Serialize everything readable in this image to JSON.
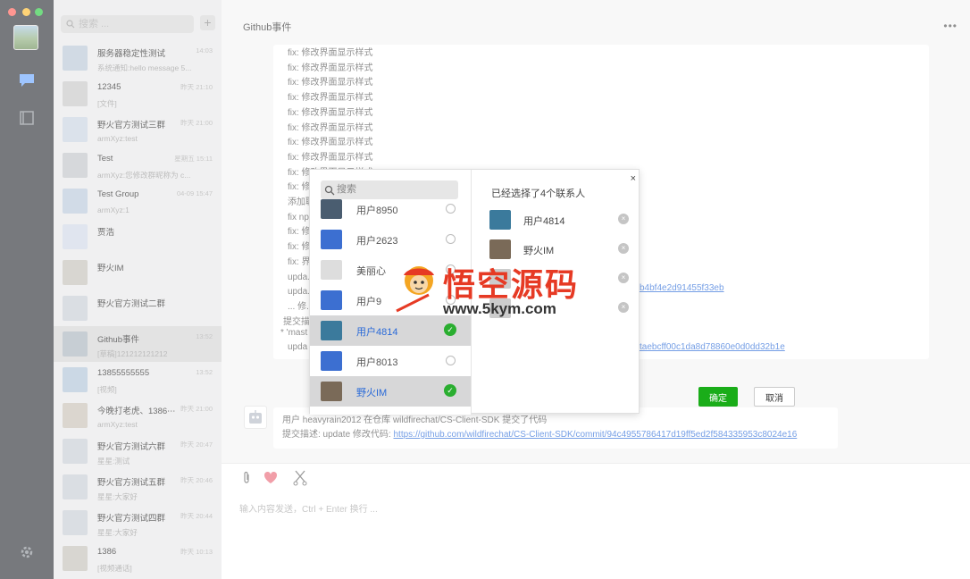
{
  "window": {
    "traffic_lights": [
      "#ff5f57",
      "#febc2e",
      "#28c840"
    ]
  },
  "sidebar": {
    "search_placeholder": "搜索 ...",
    "add_label": "+"
  },
  "conversations": [
    {
      "name": "服务器稳定性测试",
      "time": "14:03",
      "preview": "系统通知:hello message 5..."
    },
    {
      "name": "12345",
      "time": "昨天 21:10",
      "preview": "[文件]"
    },
    {
      "name": "野火官方测试三群",
      "time": "昨天 21:00",
      "preview": "armXyz:test"
    },
    {
      "name": "Test",
      "time": "星期五 15:11",
      "preview": "armXyz:您修改群昵称为 c..."
    },
    {
      "name": "Test Group",
      "time": "04-09 15:47",
      "preview": "armXyz:1"
    },
    {
      "name": "贾浩",
      "time": "",
      "preview": ""
    },
    {
      "name": "野火IM",
      "time": "",
      "preview": ""
    },
    {
      "name": "野火官方测试二群",
      "time": "",
      "preview": ""
    },
    {
      "name": "Github事件",
      "time": "13:52",
      "preview": "[草稿]121212121212"
    },
    {
      "name": "13855555555",
      "time": "13:52",
      "preview": "[视频]"
    },
    {
      "name": "今晚打老虎、1386⋯",
      "time": "昨天 21:00",
      "preview": "armXyz:test"
    },
    {
      "name": "野火官方测试六群",
      "time": "昨天 20:47",
      "preview": "星星:测试"
    },
    {
      "name": "野火官方测试五群",
      "time": "昨天 20:46",
      "preview": "星星:大家好"
    },
    {
      "name": "野火官方测试四群",
      "time": "昨天 20:44",
      "preview": "星星:大家好"
    },
    {
      "name": "1386",
      "time": "昨天 10:13",
      "preview": "[视频通话]"
    }
  ],
  "chat": {
    "title": "Github事件",
    "more": "•••",
    "lines": [
      "fix: 修改界面显示样式",
      "fix: 修改界面显示样式",
      "fix: 修改界面显示样式",
      "fix: 修改界面显示样式",
      "fix: 修改界面显示样式",
      "fix: 修改界面显示样式",
      "fix: 修改界面显示样式",
      "fix: 修改界面显示样式",
      "fix: 修改界面显示样式",
      "fix: 修改界面显示样式",
      "添加聊...",
      "fix np...",
      "fix: 修...",
      "fix: 修...",
      "fix: 界...",
      "upda...",
      "upda...",
      "... 修...",
      "提交描..."
    ],
    "link1": "b4bf4e2d91455f33eb",
    "master_line": "* 'mast",
    "update_line": "upda",
    "link2": "taebcff00c1da8d78860e0d0dd32b1e",
    "msg2_line1": "用户 heavyrain2012 在仓库 wildfirechat/CS-Client-SDK 提交了代码",
    "msg2_prefix": "提交描述: update 修改代码: ",
    "msg2_link": "https://github.com/wildfirechat/CS-Client-SDK/commit/94c4955786417d19ff5ed2f584335953c8024e16",
    "input_placeholder": "输入内容发送，Ctrl + Enter 换行 ..."
  },
  "dialog": {
    "search_placeholder": "搜索",
    "contacts": [
      {
        "name": "用户8950",
        "selected": false
      },
      {
        "name": "用户2623",
        "selected": false
      },
      {
        "name": "美丽心",
        "selected": false
      },
      {
        "name": "用户9",
        "selected": false
      },
      {
        "name": "用户4814",
        "selected": true
      },
      {
        "name": "用户8013",
        "selected": false
      },
      {
        "name": "野火IM",
        "selected": true
      }
    ],
    "selected_header": "已经选择了4个联系人",
    "selected": [
      {
        "name": "用户4814"
      },
      {
        "name": "野火IM"
      },
      {
        "name": ""
      },
      {
        "name": ""
      }
    ],
    "confirm_label": "确定",
    "cancel_label": "取消",
    "close_label": "×"
  },
  "watermark": {
    "title": "悟空源码",
    "url": "www.5kym.com"
  }
}
